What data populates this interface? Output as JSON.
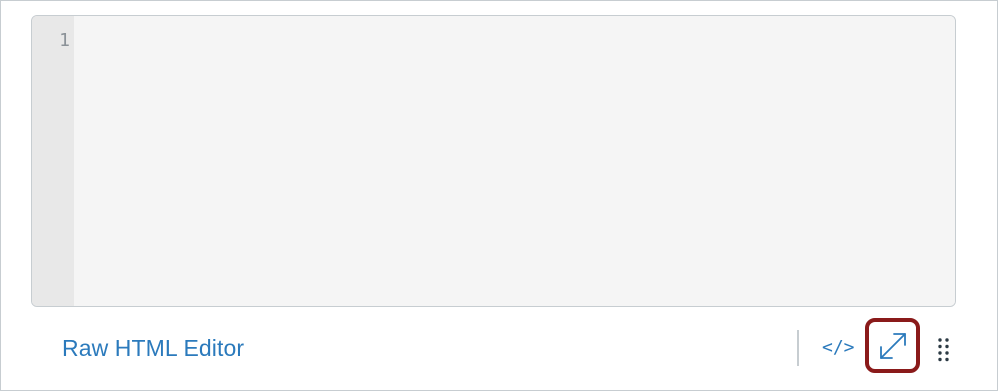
{
  "editor": {
    "line_numbers": [
      "1"
    ],
    "content": ""
  },
  "statusbar": {
    "raw_html_editor_label": "Raw HTML Editor",
    "code_toggle_label": "</>",
    "fullscreen_icon": "expand-diagonal-icon",
    "drag_icon": "drag-handle-dots-icon"
  },
  "colors": {
    "link": "#2b7abc",
    "highlight_border": "#8a1a1a",
    "editor_bg": "#f5f5f5",
    "gutter_bg": "#e8e8e8",
    "line_number": "#8b9298"
  }
}
